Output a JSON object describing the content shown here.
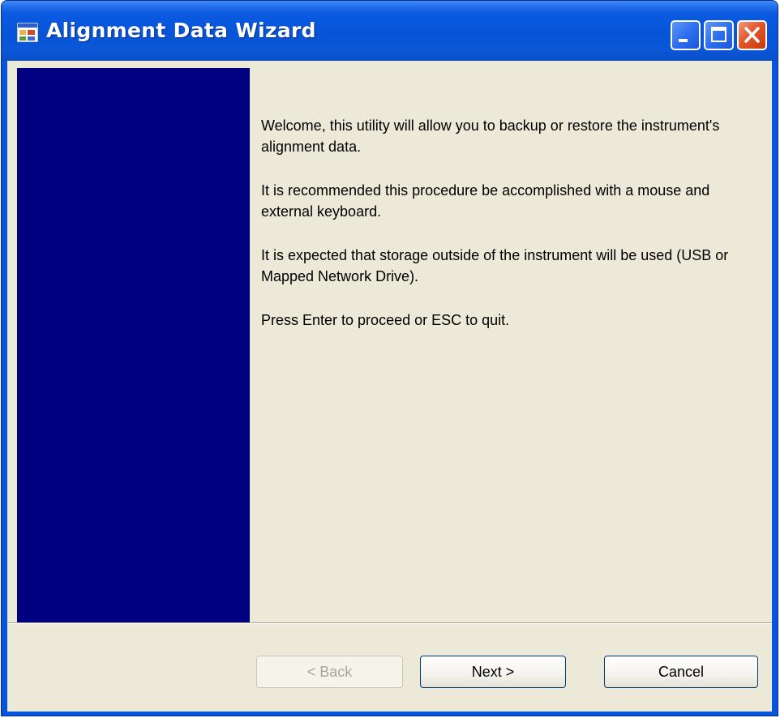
{
  "window": {
    "title": "Alignment Data Wizard"
  },
  "content": {
    "paragraphs": [
      "Welcome, this utility will allow you to backup or restore the instrument's alignment data.",
      "It is recommended this procedure be accomplished with a mouse and external keyboard.",
      "It is expected that storage outside of the instrument will be used (USB or Mapped Network Drive).",
      "Press Enter to proceed or ESC to quit."
    ]
  },
  "buttons": {
    "back": "< Back",
    "next": "Next >",
    "cancel": "Cancel"
  },
  "icons": {
    "app": "application-icon",
    "minimize": "minimize-icon",
    "maximize": "maximize-icon",
    "close": "close-icon"
  },
  "colors": {
    "side_panel": "#000080",
    "titlebar": "#0855dd",
    "client_bg": "#ece9d8"
  }
}
